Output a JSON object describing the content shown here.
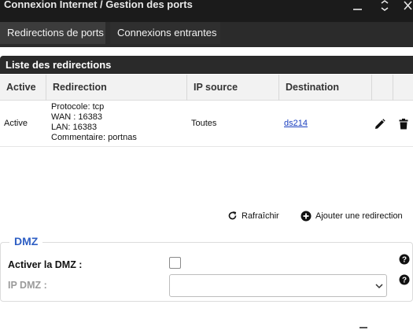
{
  "window": {
    "title": "Connexion Internet / Gestion des ports",
    "icons": [
      "minimize-icon",
      "collapse-icon",
      "close-icon"
    ]
  },
  "tabs": [
    {
      "label": "Redirections de ports",
      "active": true
    },
    {
      "label": "Connexions entrantes",
      "active": false
    }
  ],
  "panel": {
    "title": "Liste des redirections"
  },
  "table": {
    "headers": [
      "Active",
      "Redirection",
      "IP source",
      "Destination"
    ],
    "rows": [
      {
        "active": "Active",
        "protocole": "Protocole: tcp",
        "wan": "WAN : 16383",
        "lan": "LAN: 16383",
        "commentaire": "Commentaire: portnas",
        "ip_source": "Toutes",
        "destination": "ds214",
        "icons": [
          "edit-icon",
          "delete-icon"
        ]
      }
    ]
  },
  "actions": {
    "refresh": "Rafraîchir",
    "add": "Ajouter une redirection",
    "refresh_icon": "refresh-icon",
    "add_icon": "plus-circle-icon"
  },
  "dmz": {
    "legend": "DMZ",
    "enable_label": "Activer la DMZ :",
    "enable_checked": false,
    "ip_label": "IP DMZ :",
    "ip_value": "",
    "help_icon": "help-icon"
  },
  "colors": {
    "titlebar": "#1b1b1b",
    "tab_active": "#3c3c3c",
    "panel_header": "#2a2a2a",
    "link": "#1a3fbf",
    "dmz_legend": "#2f5fc4"
  }
}
